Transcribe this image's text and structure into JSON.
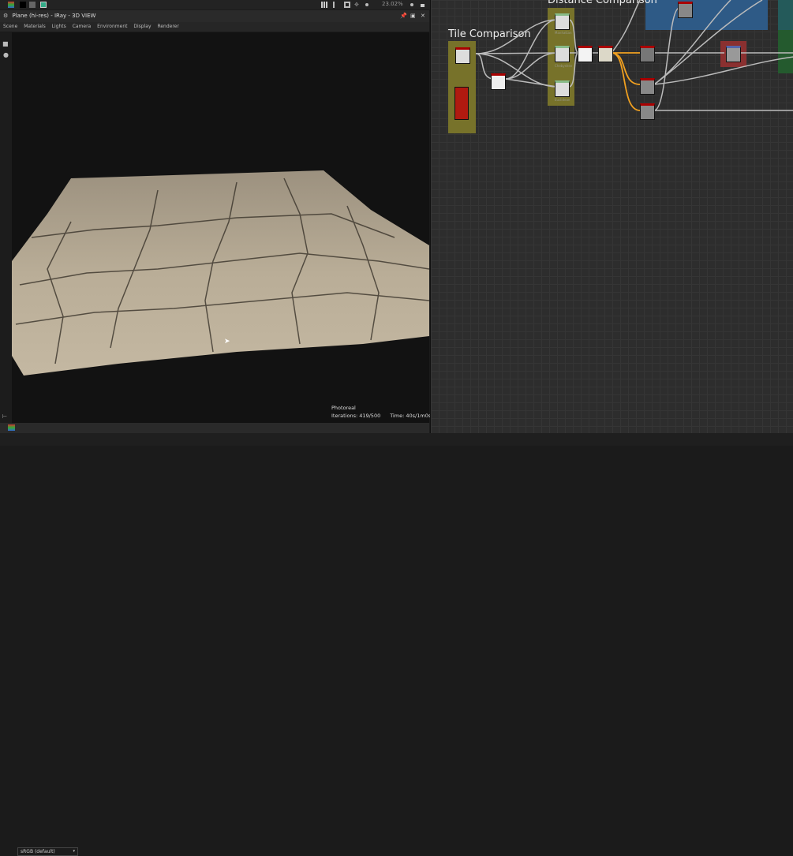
{
  "toolbar": {
    "zoom": "23.02%"
  },
  "viewport": {
    "title": "Plane (hi-res) - IRay - 3D VIEW",
    "menu": [
      "Scene",
      "Materials",
      "Lights",
      "Camera",
      "Environment",
      "Display",
      "Renderer"
    ],
    "render_mode": "Photoreal",
    "iterations": "Iterations: 419/500",
    "time": "Time: 40s/1m0s",
    "color_space": "sRGB (default)"
  },
  "graph": {
    "frames": [
      "Tile Comparison",
      "Distance Comparison"
    ],
    "node_labels": [
      "Manhattan",
      "Chebyshev",
      "Euclidean"
    ]
  },
  "colors": {
    "tile_frame": "#77722a",
    "distance_frame": "#77722a",
    "blue_frame": "#2e5a86",
    "green_frame": "#245a2e",
    "wire_orange": "#f0a020"
  }
}
